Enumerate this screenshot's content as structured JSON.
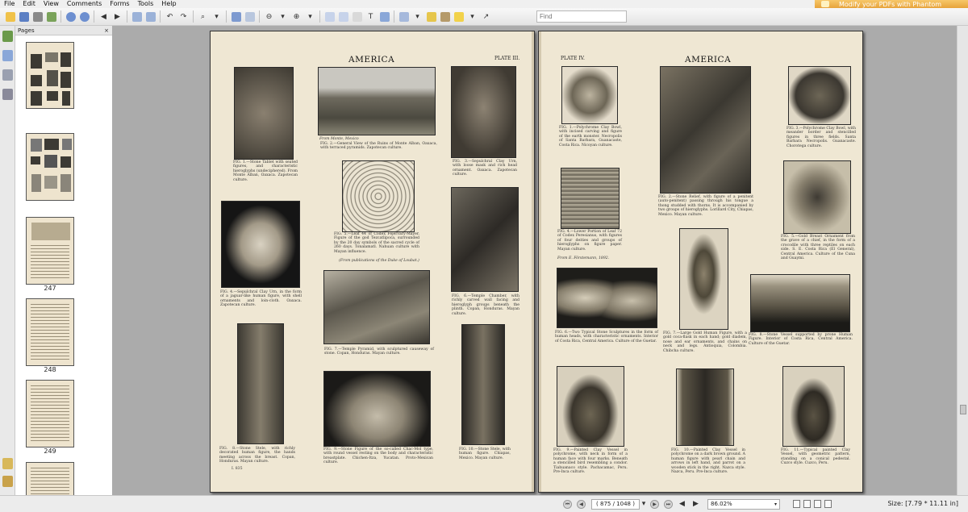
{
  "menu": {
    "items": [
      "File",
      "Edit",
      "View",
      "Comments",
      "Forms",
      "Tools",
      "Help"
    ]
  },
  "promo": {
    "label": "Modify your PDFs with Phantom"
  },
  "toolbar": {
    "find_placeholder": "Find"
  },
  "sidebar": {
    "title": "Pages",
    "pages": [
      {
        "label": ""
      },
      {
        "label": ""
      },
      {
        "label": "247"
      },
      {
        "label": "248"
      },
      {
        "label": "249"
      },
      {
        "label": ""
      }
    ]
  },
  "document": {
    "left_page": {
      "title": "AMERICA",
      "plate": "PLATE III.",
      "footer": "I. 835",
      "captions": [
        "FIG. 1.—Stone Tablet with seated figures, and characteristic hieroglyphs (undeciphered). From Monte Alban, Oaxaca. Zapotecan culture.",
        "From Monte, Mexico",
        "FIG. 2.—General View of the Ruins of Monte Alban, Oaxaca, with terraced pyramids. Zapotecan culture.",
        "FIG. 3.—Sepulchral Clay Urn, with loose mask and rich head ornament. Oaxaca. Zapotecan culture.",
        "FIG. 4.—Sepulchral Clay Urn, in the form of a jaguar-like human figure, with shell ornaments and loin-cloth. Oaxaca. Zapotecan culture.",
        "FIG. 5.—Leaf 44 of Codex Fejérváry-Mayer. Figure of the god Tezcatlipoca, surrounded by the 20 day symbols of the sacred cycle of 260 days. Tonalamatl. Nahuan culture with Mayan influence.",
        "(From publications of the Duke of Loubat.)",
        "FIG. 6.—Temple Chamber, with richly carved wall facing and hieroglyph groups beneath the plinth. Copan, Honduras. Mayan culture.",
        "FIG. 7.—Temple Pyramid, with sculptured causeway of stone. Copan, Honduras. Mayan culture.",
        "FIG. 8.—Stone Stele, with richly decorated human figure, the hands meeting across the breast. Copan, Honduras. Mayan culture.",
        "FIG. 9.—Stone Figure of the so-called Chac-Mol type, with round vessel resting on the body and characteristic breastplate. Chichen-Itza, Yucatan. Proto-Mexican culture.",
        "FIG. 10.—Stone Stele, with human figure. Chiapas, Mexico. Mayan culture."
      ]
    },
    "right_page": {
      "title": "AMERICA",
      "plate": "PLATE IV.",
      "captions": [
        "FIG. 1.—Polychrome Clay Bowl, with incised carving and figure of the earth monster. Necropolis of Santa Barbara, Guanacaste, Costa Rica. Nicoyan culture.",
        "FIG. 2.—Stone Relief, with figure of a penitent (auto-penitent) passing through his tongue a thong studded with thorns. It is accompanied by two groups of hieroglyphs. Lorillard City, Chiapas, Mexico. Mayan culture.",
        "FIG. 3.—Polychrome Clay Bowl, with meander border and stencilled figures in three fields. Santa Barbara Necropolis. Guanacaste. Chorotega culture.",
        "FIG. 4.—Lower Portion of Leaf 72 of Codex Peresianus, with figures of four deities and groups of hieroglyphs on figure paper. Mayan culture.",
        "From E. Förstemann, 1892.",
        "FIG. 5.—Gold Breast Ornament from the grave of a chief, in the form of a crocodile with three reptiles on each side. S. E. Costa Rica (El General), Central America. Culture of the Cuna and Guaymi.",
        "FIG. 6.—Two Typical Stone Sculptures in the form of human heads, with characteristic ornaments. Interior of Costa Rica, Central America. Culture of the Guetar.",
        "FIG. 7.—Large Gold Human Figure, with a gold coca-flask in each hand; gold diadem, nose and ear ornaments, and chains on neck and legs. Antioquia, Colombia. Chibcha culture.",
        "FIG. 8.—Stone Vessel supported by prone Human Figure. Interior of Costa Rica, Central America. Culture of the Guetar.",
        "FIG. 9.—Painted Clay Vessel in polychrome, with neck in form of a human face with four marks. Beneath a stencilled bird resembling a condor. Tiahuanaco style. Pachacamac, Peru. Pre-Inca culture.",
        "FIG. 10.—Painted Clay Vessel in polychrome on a dark brown ground. A human figure with pearl chain and arrows in left hand, and parrot on a wooden stick in the right. Nazca style. Nazca, Peru. Pre-Inca culture.",
        "FIG. 11.—Typical painted Clay Vessel, with geometric pattern, standing on a conical pedestal. Cuzco style. Cuzco, Peru."
      ]
    }
  },
  "statusbar": {
    "page_indicator": "( 875 / 1048 )",
    "zoom": "86.02%",
    "size": "Size: [7.79 * 11.11 in]"
  },
  "colors": {
    "page": "#efe7d3",
    "viewer_bg": "#ababab",
    "promo": "#e7a33b"
  }
}
